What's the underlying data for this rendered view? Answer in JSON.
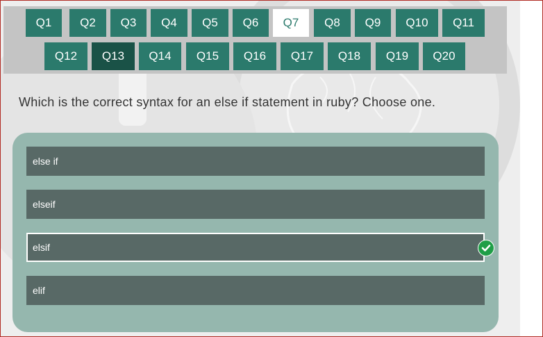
{
  "questions": [
    {
      "label": "Q1"
    },
    {
      "label": "Q2"
    },
    {
      "label": "Q3"
    },
    {
      "label": "Q4"
    },
    {
      "label": "Q5"
    },
    {
      "label": "Q6"
    },
    {
      "label": "Q7"
    },
    {
      "label": "Q8"
    },
    {
      "label": "Q9"
    },
    {
      "label": "Q10"
    },
    {
      "label": "Q11"
    },
    {
      "label": "Q12"
    },
    {
      "label": "Q13"
    },
    {
      "label": "Q14"
    },
    {
      "label": "Q15"
    },
    {
      "label": "Q16"
    },
    {
      "label": "Q17"
    },
    {
      "label": "Q18"
    },
    {
      "label": "Q19"
    },
    {
      "label": "Q20"
    }
  ],
  "current_question": "Q7",
  "active_question": "Q13",
  "question_text": "Which is the correct syntax for an else if statement in ruby? Choose one.",
  "options": [
    {
      "label": "else if"
    },
    {
      "label": "elseif"
    },
    {
      "label": "elsif"
    },
    {
      "label": "elif"
    }
  ],
  "selected_option": "elsif",
  "correct_indicator_icon": "checkmark-icon",
  "colors": {
    "button": "#2b7a6c",
    "button_active": "#1a5247",
    "panel": "#95b7ae",
    "option": "#586966",
    "correct": "#1f9e47"
  }
}
